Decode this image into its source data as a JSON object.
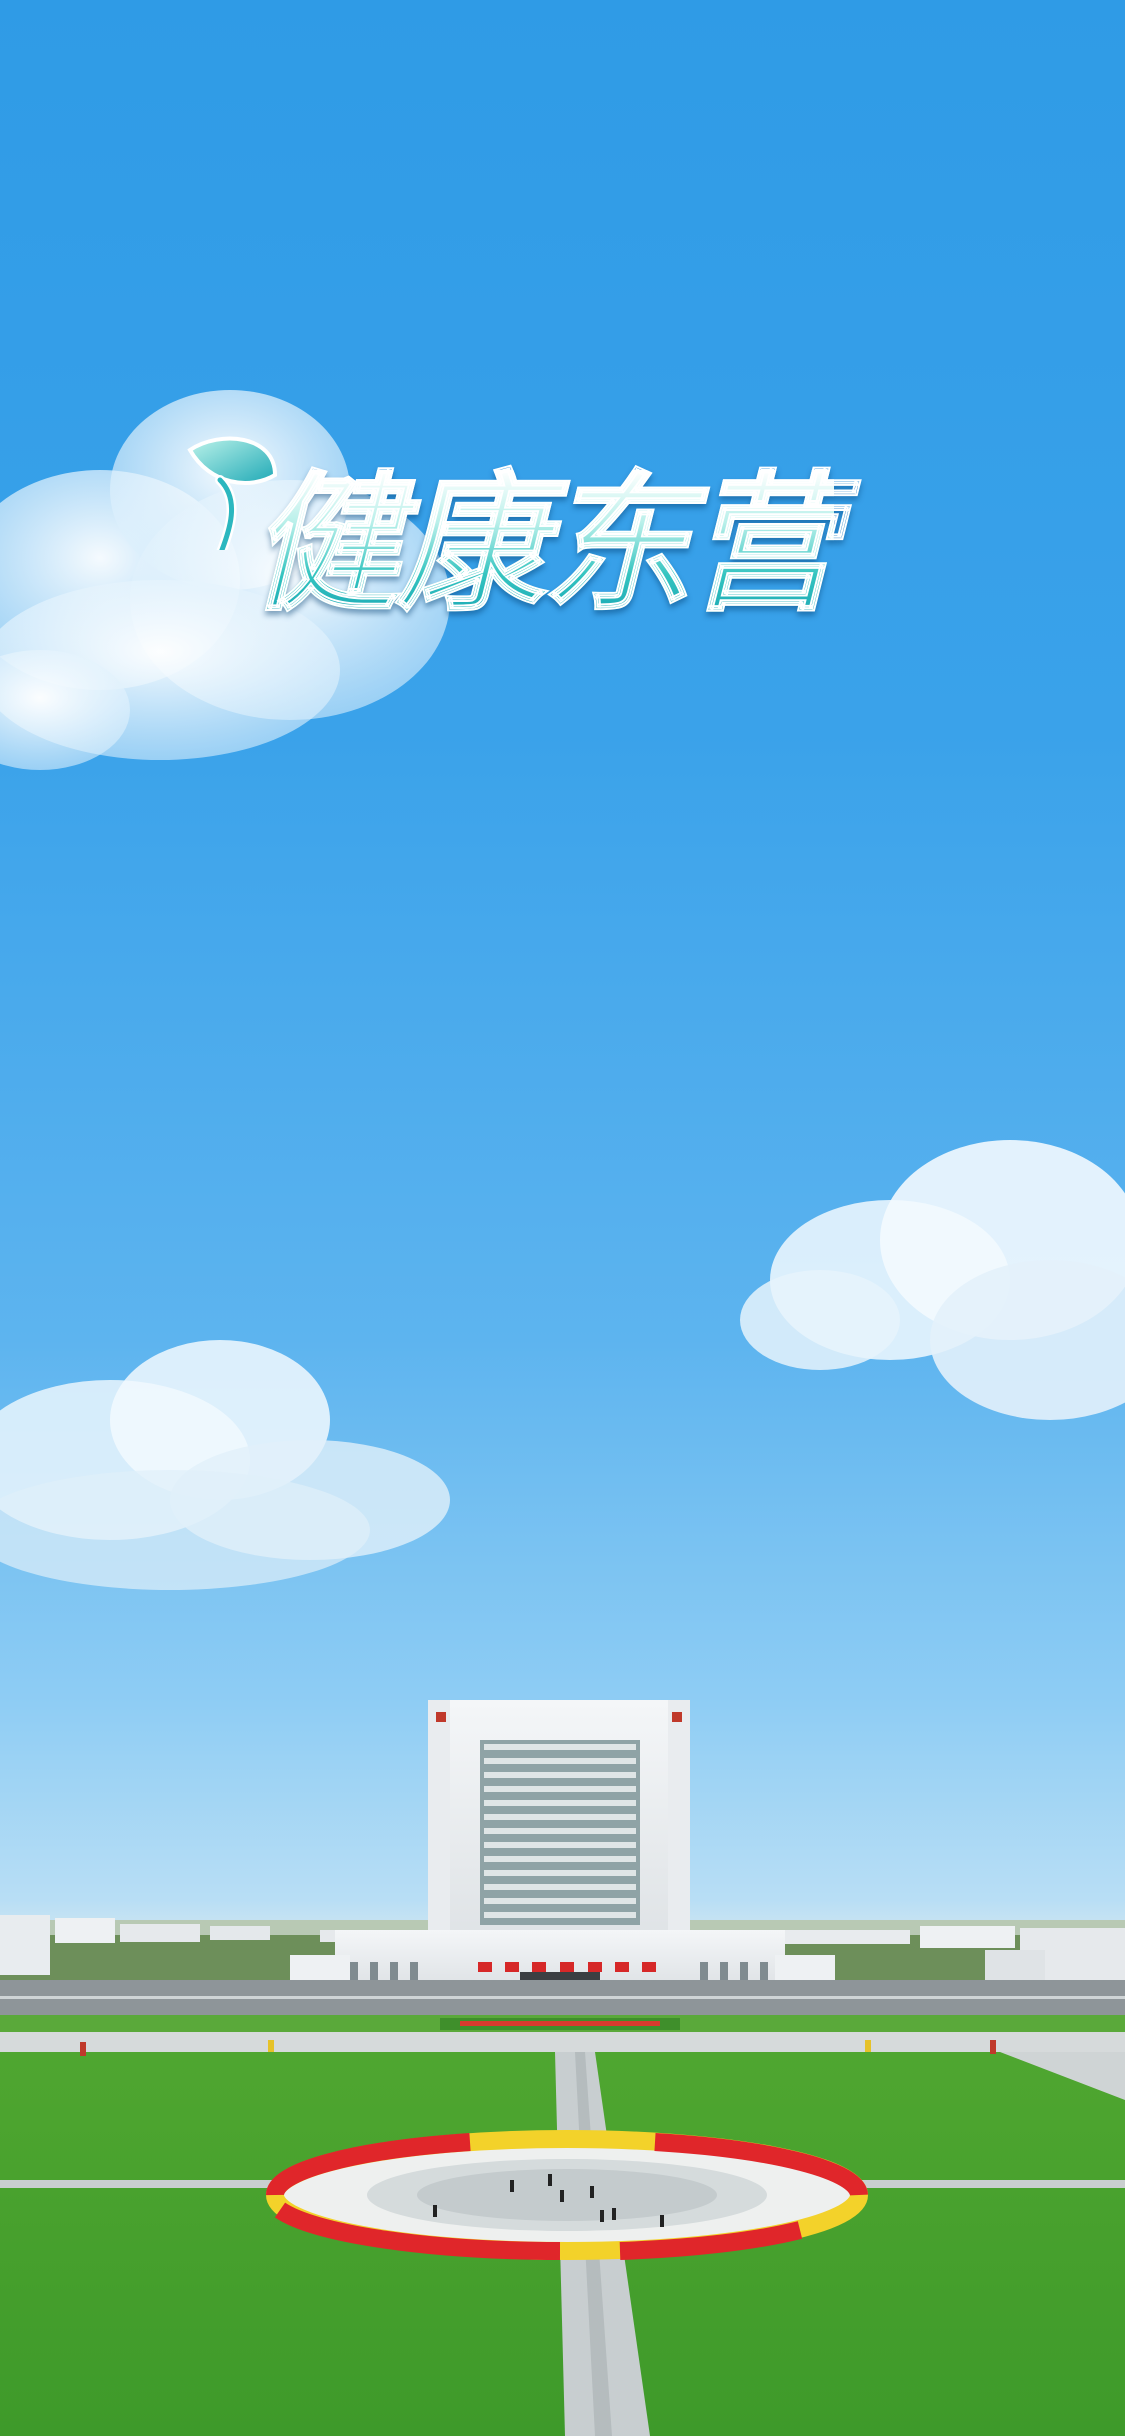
{
  "app": {
    "logo_text": "健康东营"
  },
  "colors": {
    "sky_top": "#2f9be6",
    "sky_bottom": "#d7e9f0",
    "logo_teal": "#1aa6b4",
    "grass": "#4fa630",
    "flowers_red": "#e0262a",
    "flowers_yellow": "#f3d22a"
  },
  "scene": {
    "subject": "city-hall-plaza",
    "icons": [
      "leaf-icon",
      "cloud-icon"
    ]
  }
}
